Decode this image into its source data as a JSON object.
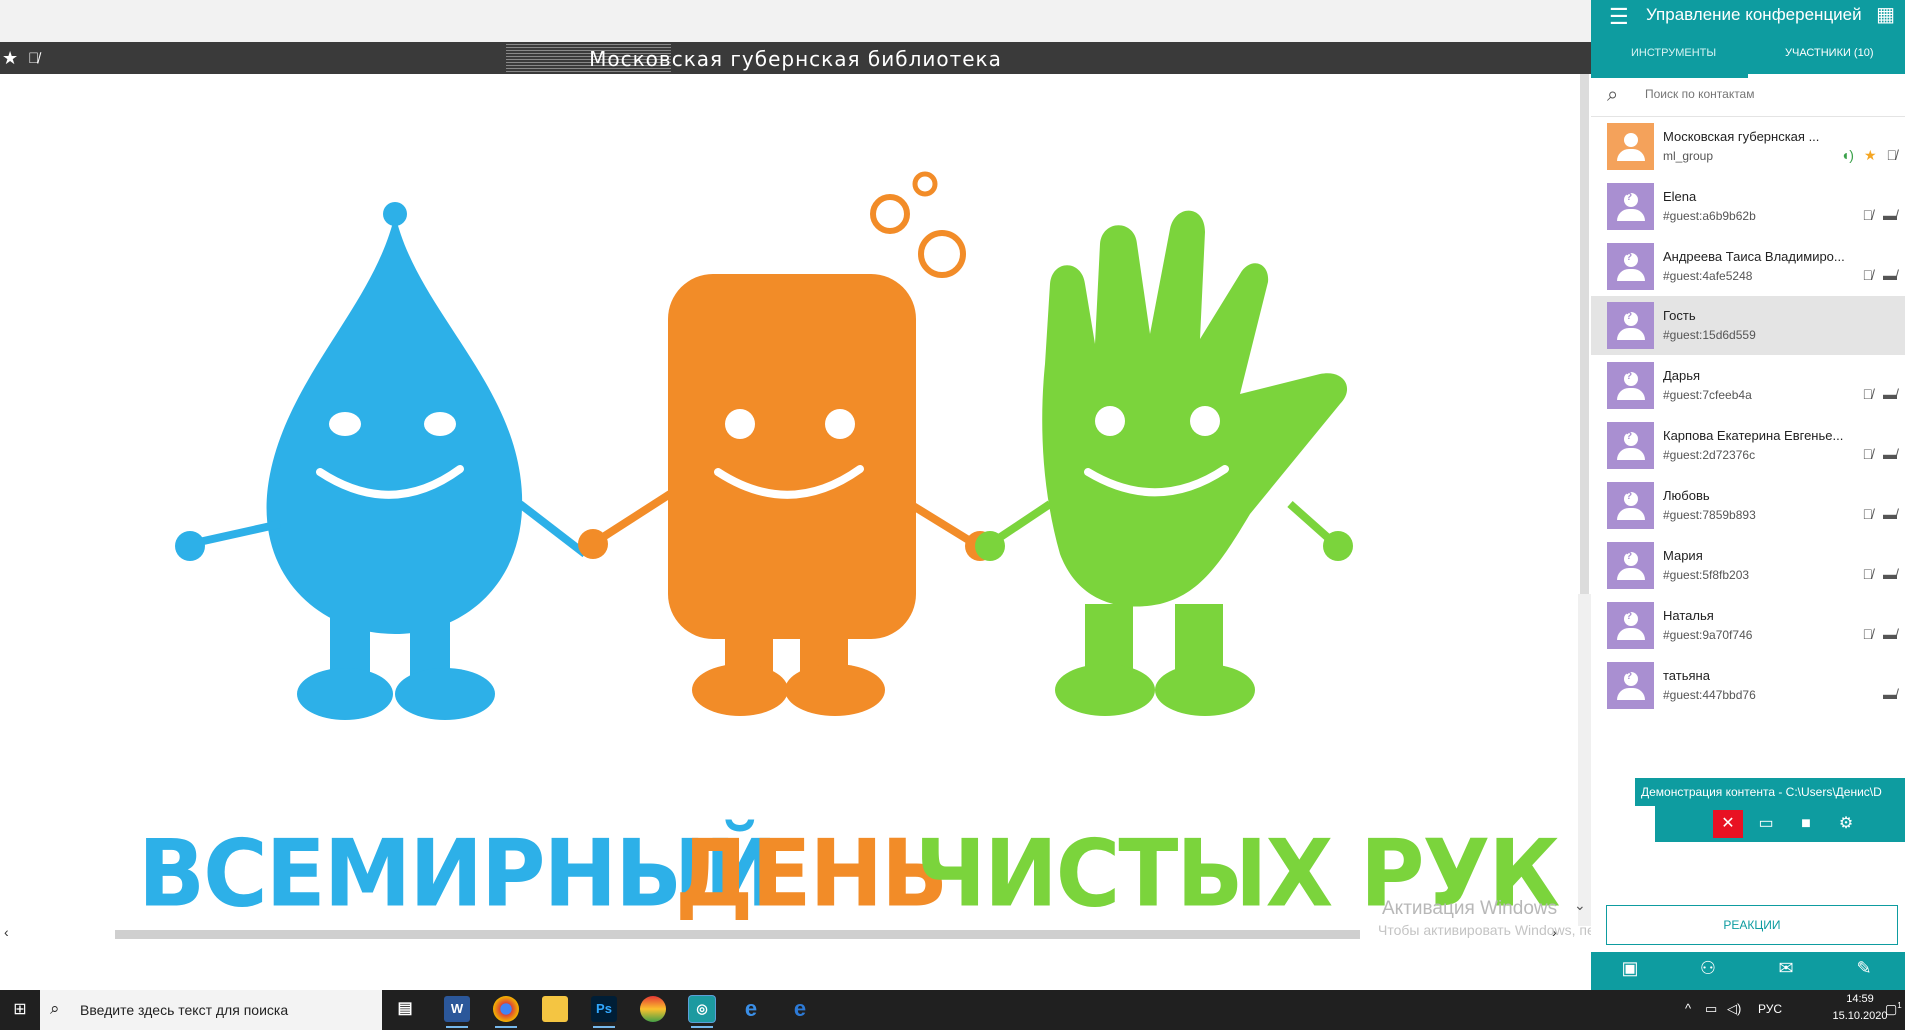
{
  "stage": {
    "title": "Московская губернская библиотека",
    "banner": {
      "word1": "ВСЕМИРНЫЙ",
      "word2": "ДЕНЬ",
      "word3": "ЧИСТЫХ РУК",
      "color1": "#2db0e8",
      "color2": "#f28c28",
      "color3": "#7bd43c"
    },
    "watermark_title": "Активация Windows",
    "watermark_text": "Чтобы активировать Windows, перейдите в раздел \"Параметры\"."
  },
  "panel": {
    "title": "Управление конференцией",
    "tabs": [
      {
        "label": "ИНСТРУМЕНТЫ"
      },
      {
        "label": "УЧАСТНИКИ (10)"
      }
    ],
    "search_placeholder": "Поиск по контактам",
    "participants": [
      {
        "name": "Московская губернская ...",
        "id": "ml_group"
      },
      {
        "name": "Elena",
        "id": "#guest:a6b9b62b"
      },
      {
        "name": "Андреева Таиса Владимиро...",
        "id": "#guest:4afe5248"
      },
      {
        "name": "Гость",
        "id": "#guest:15d6d559"
      },
      {
        "name": "Дарья",
        "id": "#guest:7cfeeb4a"
      },
      {
        "name": "Карпова Екатерина Евгенье...",
        "id": "#guest:2d72376c"
      },
      {
        "name": "Любовь",
        "id": "#guest:7859b893"
      },
      {
        "name": "Мария",
        "id": "#guest:5f8fb203"
      },
      {
        "name": "Наталья",
        "id": "#guest:9a70f746"
      },
      {
        "name": "татьяна",
        "id": "#guest:447bbd76"
      }
    ],
    "demo_label": "Демонстрация контента - C:\\Users\\Денис\\D",
    "reactions_label": "РЕАКЦИИ",
    "accent_color": "#0e9ca0"
  },
  "taskbar": {
    "search_placeholder": "Введите здесь текст для поиска",
    "lang": "РУС",
    "time": "14:59",
    "date": "15.10.2020",
    "notif_count": "1"
  }
}
